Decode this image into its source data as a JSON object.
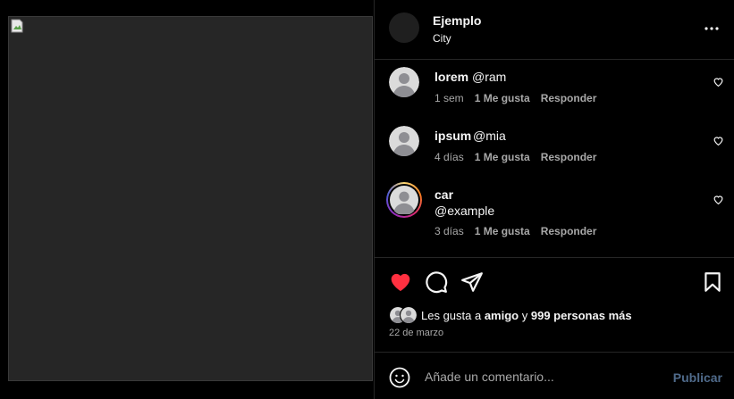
{
  "post": {
    "media_alt": ""
  },
  "header": {
    "username": "Ejemplo",
    "location": "City"
  },
  "comments": [
    {
      "user": "lorem",
      "text": "@ram",
      "time": "1 sem",
      "likes": "1 Me gusta",
      "reply": "Responder",
      "story_ring": false
    },
    {
      "user": "ipsum",
      "text": "@mia",
      "time": "4 días",
      "likes": "1 Me gusta",
      "reply": "Responder",
      "story_ring": false
    },
    {
      "user": "car",
      "text": "@example",
      "time": "3 días",
      "likes": "1 Me gusta",
      "reply": "Responder",
      "story_ring": true
    }
  ],
  "likes": {
    "prefix": "Les gusta a ",
    "friend": "amigo",
    "middle": " y ",
    "others": "999 personas más"
  },
  "date": "22 de marzo",
  "comment_input": {
    "placeholder": "Añade un comentario...",
    "publish_label": "Publicar"
  },
  "colors": {
    "background": "#000000",
    "like_red": "#ff3040",
    "muted_text": "#a8a8a8",
    "publish_disabled": "#4f6a8a"
  },
  "icons": [
    "more-options-icon",
    "heart-icon",
    "comment-icon",
    "share-icon",
    "bookmark-icon",
    "emoji-icon",
    "default-avatar-icon"
  ]
}
